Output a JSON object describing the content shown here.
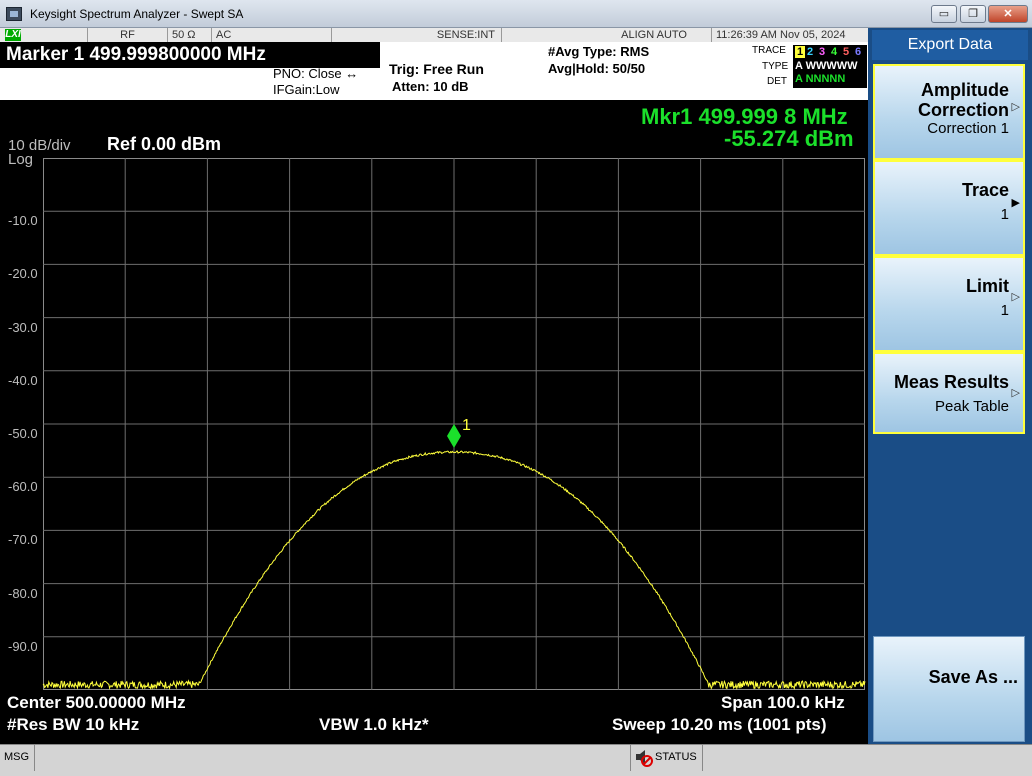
{
  "window": {
    "title": "Keysight Spectrum Analyzer - Swept SA",
    "min_label": "▭",
    "max_label": "❐",
    "close_label": "✕"
  },
  "status_strip": {
    "lxi": "LXI",
    "rf": "RF",
    "impedance": "50 Ω",
    "coupling": "AC",
    "sense": "SENSE:INT",
    "align": "ALIGN AUTO",
    "datetime": "11:26:39 AM Nov 05, 2024"
  },
  "info": {
    "marker_title": "Marker 1 499.999800000 MHz",
    "pno": "PNO: Close ↔",
    "ifgain": "IFGain:Low",
    "trig": "Trig: Free Run",
    "atten": "Atten: 10 dB",
    "avg_type": "#Avg Type: RMS",
    "avg_hold": "Avg|Hold: 50/50",
    "trace_label": "TRACE",
    "type_label": "TYPE",
    "det_label": "DET",
    "trace_nums": [
      "1",
      "2",
      "3",
      "4",
      "5",
      "6"
    ],
    "trace_colors": [
      "#ffff3c",
      "#39d2ff",
      "#ff60ff",
      "#39ff39",
      "#ff6060",
      "#7a7aff"
    ],
    "type_value": "A WWWWW",
    "det_value": "A NNNNN"
  },
  "marker_readout": {
    "freq": "Mkr1 499.999 8 MHz",
    "level": "-55.274 dBm"
  },
  "scale": {
    "per_div": "10 dB/div",
    "log": "Log",
    "ref": "Ref 0.00 dBm",
    "y_ticks": [
      "-10.0",
      "-20.0",
      "-30.0",
      "-40.0",
      "-50.0",
      "-60.0",
      "-70.0",
      "-80.0",
      "-90.0"
    ]
  },
  "bottom": {
    "center": "Center 500.00000 MHz",
    "span": "Span 100.0 kHz",
    "rbw": "#Res BW 10 kHz",
    "vbw": "VBW 1.0 kHz*",
    "sweep": "Sweep  10.20 ms (1001 pts)"
  },
  "marker_label": "1",
  "softkeys": {
    "title": "Export Data",
    "items": [
      {
        "l1": "Amplitude",
        "l1b": "Correction",
        "l2": "Correction 1"
      },
      {
        "l1": "Trace",
        "l2": "1"
      },
      {
        "l1": "Limit",
        "l2": "1"
      },
      {
        "l1": "Meas Results",
        "l2": "Peak Table"
      },
      {
        "l1": "Save As ..."
      }
    ]
  },
  "msgbar": {
    "msg": "MSG",
    "status": "STATUS"
  },
  "chart_data": {
    "type": "line",
    "series": [
      {
        "name": "Trace 1",
        "color": "#ffff3c"
      }
    ],
    "x_center_mhz": 500.0,
    "x_span_khz": 100.0,
    "y_ref_dbm": 0.0,
    "y_scale_db_per_div": 10,
    "ylim": [
      -100,
      0
    ],
    "peak": {
      "freq_mhz": 499.9998,
      "level_dbm": -55.274
    },
    "noise_floor_dbm": -99,
    "signal_edges_khz": [
      -31,
      31
    ]
  }
}
